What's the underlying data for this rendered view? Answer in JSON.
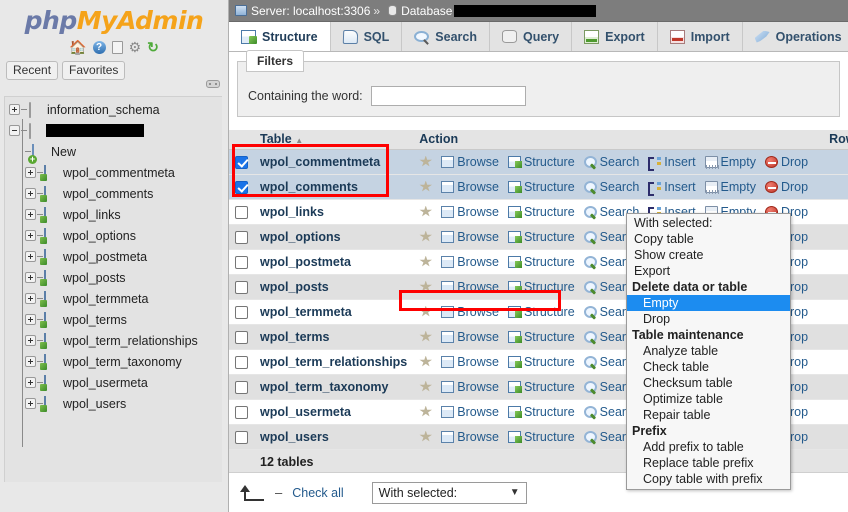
{
  "brand": {
    "php": "php",
    "my": "My",
    "admin": "Admin"
  },
  "sidebar": {
    "quick_icons": [
      {
        "name": "home-icon",
        "glyph": "🏠"
      },
      {
        "name": "help-icon",
        "glyph": "?"
      },
      {
        "name": "docs-icon",
        "glyph": "🗋"
      },
      {
        "name": "settings-icon",
        "glyph": "⚙"
      },
      {
        "name": "reload-icon",
        "glyph": "↻"
      }
    ],
    "recent_label": "Recent",
    "favorites_label": "Favorites",
    "tree": [
      {
        "label": "information_schema",
        "type": "db",
        "state": "collapsed",
        "indent": 0
      },
      {
        "label": "",
        "type": "db",
        "state": "expanded",
        "indent": 0,
        "redacted": true
      },
      {
        "label": "New",
        "type": "new",
        "state": "none",
        "indent": 1
      },
      {
        "label": "wpol_commentmeta",
        "type": "table",
        "state": "collapsed",
        "indent": 1
      },
      {
        "label": "wpol_comments",
        "type": "table",
        "state": "collapsed",
        "indent": 1
      },
      {
        "label": "wpol_links",
        "type": "table",
        "state": "collapsed",
        "indent": 1
      },
      {
        "label": "wpol_options",
        "type": "table",
        "state": "collapsed",
        "indent": 1
      },
      {
        "label": "wpol_postmeta",
        "type": "table",
        "state": "collapsed",
        "indent": 1
      },
      {
        "label": "wpol_posts",
        "type": "table",
        "state": "collapsed",
        "indent": 1
      },
      {
        "label": "wpol_termmeta",
        "type": "table",
        "state": "collapsed",
        "indent": 1
      },
      {
        "label": "wpol_terms",
        "type": "table",
        "state": "collapsed",
        "indent": 1
      },
      {
        "label": "wpol_term_relationships",
        "type": "table",
        "state": "collapsed",
        "indent": 1
      },
      {
        "label": "wpol_term_taxonomy",
        "type": "table",
        "state": "collapsed",
        "indent": 1
      },
      {
        "label": "wpol_usermeta",
        "type": "table",
        "state": "collapsed",
        "indent": 1
      },
      {
        "label": "wpol_users",
        "type": "table",
        "state": "collapsed",
        "indent": 1
      }
    ]
  },
  "breadcrumb": {
    "server_label": "Server: localhost:3306",
    "separator": "»",
    "database_label": "Database",
    "database_name_redacted": true
  },
  "tabs": [
    {
      "label": "Structure",
      "icon": "structure-icon",
      "active": true
    },
    {
      "label": "SQL",
      "icon": "sql-icon",
      "active": false
    },
    {
      "label": "Search",
      "icon": "search-icon",
      "active": false
    },
    {
      "label": "Query",
      "icon": "query-icon",
      "active": false
    },
    {
      "label": "Export",
      "icon": "export-icon",
      "active": false
    },
    {
      "label": "Import",
      "icon": "import-icon",
      "active": false
    },
    {
      "label": "Operations",
      "icon": "operations-icon",
      "active": false
    }
  ],
  "filters": {
    "legend": "Filters",
    "word_label": "Containing the word:",
    "word_value": "",
    "word_placeholder": ""
  },
  "table": {
    "headers": {
      "table": "Table",
      "action": "Action",
      "rows": "Rows"
    },
    "sort_indicator": "▲",
    "action_labels": {
      "favorite": "",
      "browse": "Browse",
      "structure": "Structure",
      "search": "Search",
      "insert": "Insert",
      "empty": "Empty",
      "drop": "Drop"
    },
    "rows": [
      {
        "name": "wpol_commentmeta",
        "checked": true
      },
      {
        "name": "wpol_comments",
        "checked": true
      },
      {
        "name": "wpol_links",
        "checked": false
      },
      {
        "name": "wpol_options",
        "checked": false
      },
      {
        "name": "wpol_postmeta",
        "checked": false
      },
      {
        "name": "wpol_posts",
        "checked": false
      },
      {
        "name": "wpol_termmeta",
        "checked": false
      },
      {
        "name": "wpol_terms",
        "checked": false
      },
      {
        "name": "wpol_term_relationships",
        "checked": false
      },
      {
        "name": "wpol_term_taxonomy",
        "checked": false
      },
      {
        "name": "wpol_usermeta",
        "checked": false
      },
      {
        "name": "wpol_users",
        "checked": false
      }
    ],
    "total_label": "12 tables"
  },
  "bottom": {
    "check_all_label": "Check all",
    "dash": "–",
    "with_selected_label": "With selected:",
    "chevron": "▼"
  },
  "context_menu": {
    "items": [
      {
        "label": "With selected:",
        "kind": "item"
      },
      {
        "label": "Copy table",
        "kind": "item"
      },
      {
        "label": "Show create",
        "kind": "item"
      },
      {
        "label": "Export",
        "kind": "item"
      },
      {
        "label": "Delete data or table",
        "kind": "group"
      },
      {
        "label": "Empty",
        "kind": "child",
        "highlighted": true
      },
      {
        "label": "Drop",
        "kind": "child"
      },
      {
        "label": "Table maintenance",
        "kind": "group"
      },
      {
        "label": "Analyze table",
        "kind": "child"
      },
      {
        "label": "Check table",
        "kind": "child"
      },
      {
        "label": "Checksum table",
        "kind": "child"
      },
      {
        "label": "Optimize table",
        "kind": "child"
      },
      {
        "label": "Repair table",
        "kind": "child"
      },
      {
        "label": "Prefix",
        "kind": "group"
      },
      {
        "label": "Add prefix to table",
        "kind": "child"
      },
      {
        "label": "Replace table prefix",
        "kind": "child"
      },
      {
        "label": "Copy table with prefix",
        "kind": "child"
      }
    ]
  },
  "annotations": {
    "highlight_color": "#fe0000",
    "selected_rows_box": "wpol_commentmeta, wpol_comments",
    "menu_item_box": "Empty"
  }
}
